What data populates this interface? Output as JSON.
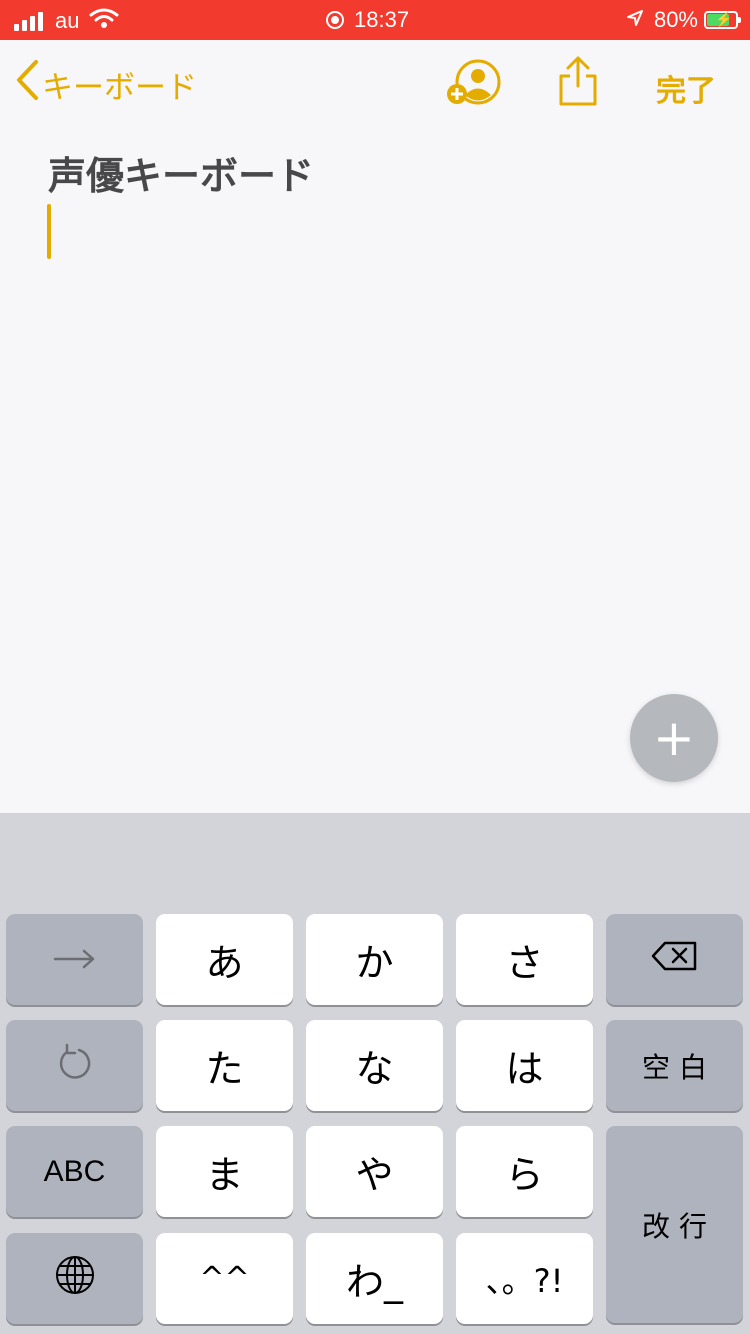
{
  "status_bar": {
    "carrier": "au",
    "time": "18:37",
    "battery_percent": "80%",
    "battery_level": 0.8,
    "battery_color": "#4cd964",
    "icons": [
      "signal-icon",
      "wifi-icon",
      "screen-record-icon",
      "location-arrow-icon",
      "battery-icon"
    ]
  },
  "nav": {
    "back_label": "キーボード",
    "done_label": "完了",
    "accent": "#e5ac00",
    "icons": [
      "chevron-left-icon",
      "add-person-icon",
      "share-icon"
    ]
  },
  "note": {
    "title": "声優キーボード"
  },
  "fab": {
    "label": "+"
  },
  "keyboard": {
    "row1": {
      "left": "→",
      "keys": [
        "あ",
        "か",
        "さ"
      ],
      "right": "⌫"
    },
    "row2": {
      "left": "↺",
      "keys": [
        "た",
        "な",
        "は"
      ],
      "right": "空 白"
    },
    "row3": {
      "left": "ABC",
      "keys": [
        "ま",
        "や",
        "ら"
      ],
      "right": "改 行"
    },
    "row4": {
      "left": "globe",
      "keys": [
        "^^",
        "わ_",
        "、。?!"
      ]
    }
  }
}
